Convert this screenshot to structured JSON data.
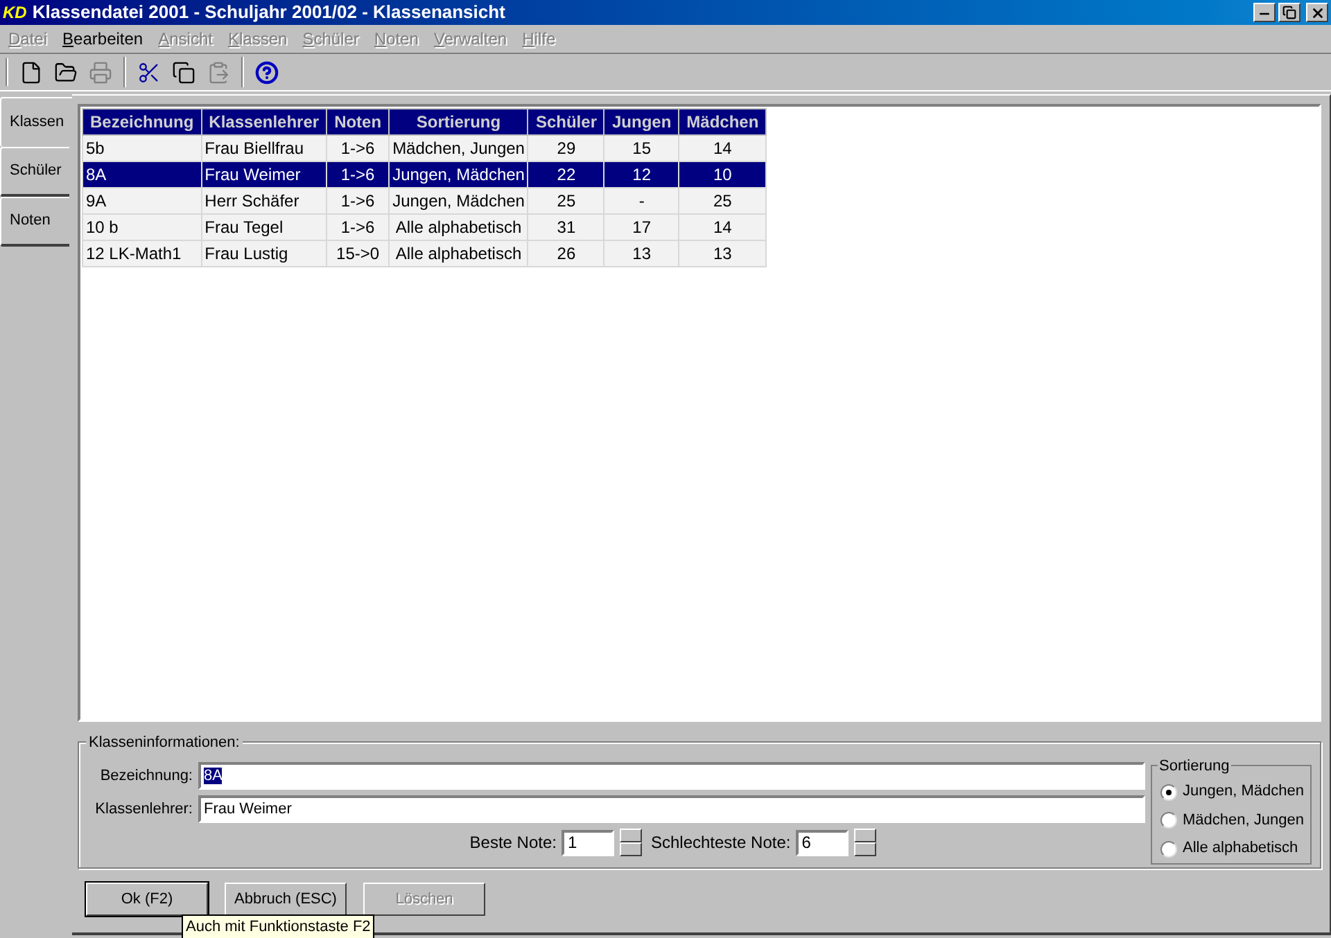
{
  "window": {
    "title": "Klassendatei 2001 - Schuljahr 2001/02 - Klassenansicht",
    "logo": "KD"
  },
  "menu": [
    {
      "label": "Datei",
      "disabled": true
    },
    {
      "label": "Bearbeiten",
      "disabled": false
    },
    {
      "label": "Ansicht",
      "disabled": true
    },
    {
      "label": "Klassen",
      "disabled": true
    },
    {
      "label": "Schüler",
      "disabled": true
    },
    {
      "label": "Noten",
      "disabled": true
    },
    {
      "label": "Verwalten",
      "disabled": true
    },
    {
      "label": "Hilfe",
      "disabled": true
    }
  ],
  "toolbar": [
    {
      "kind": "new",
      "disabled": false
    },
    {
      "kind": "open",
      "disabled": false
    },
    {
      "kind": "print",
      "disabled": true
    },
    {
      "kind": "sep"
    },
    {
      "kind": "cut",
      "disabled": false
    },
    {
      "kind": "copy",
      "disabled": false
    },
    {
      "kind": "paste",
      "disabled": true
    },
    {
      "kind": "sep"
    },
    {
      "kind": "help",
      "disabled": false
    }
  ],
  "side_tabs": [
    {
      "label": "Klassen",
      "selected": true
    },
    {
      "label": "Schüler",
      "selected": false
    },
    {
      "label": "Noten",
      "selected": false
    }
  ],
  "table": {
    "columns": [
      "Bezeichnung",
      "Klassenlehrer",
      "Noten",
      "Sortierung",
      "Schüler",
      "Jungen",
      "Mädchen"
    ],
    "rows": [
      {
        "cells": [
          "5b",
          "Frau Biellfrau",
          "1->6",
          "Mädchen, Jungen",
          "29",
          "15",
          "14"
        ],
        "selected": false
      },
      {
        "cells": [
          "8A",
          "Frau Weimer",
          "1->6",
          "Jungen, Mädchen",
          "22",
          "12",
          "10"
        ],
        "selected": true
      },
      {
        "cells": [
          "9A",
          "Herr Schäfer",
          "1->6",
          "Jungen, Mädchen",
          "25",
          "-",
          "25"
        ],
        "selected": false
      },
      {
        "cells": [
          "10 b",
          "Frau Tegel",
          "1->6",
          "Alle alphabetisch",
          "31",
          "17",
          "14"
        ],
        "selected": false
      },
      {
        "cells": [
          "12 LK-Math1",
          "Frau Lustig",
          "15->0",
          "Alle alphabetisch",
          "26",
          "13",
          "13"
        ],
        "selected": false
      }
    ]
  },
  "info": {
    "title": "Klasseninformationen:",
    "name_label": "Bezeichnung:",
    "name_value": "8A",
    "teacher_label": "Klassenlehrer:",
    "teacher_value": "Frau Weimer",
    "best_label": "Beste Note:",
    "best_value": "1",
    "worst_label": "Schlechteste Note:",
    "worst_value": "6",
    "sort": {
      "title": "Sortierung",
      "options": [
        {
          "label": "Jungen, Mädchen",
          "selected": true
        },
        {
          "label": "Mädchen, Jungen",
          "selected": false
        },
        {
          "label": "Alle alphabetisch",
          "selected": false
        }
      ]
    }
  },
  "buttons": [
    {
      "label": "Ok (F2)",
      "default": true,
      "disabled": false
    },
    {
      "label": "Abbruch (ESC)",
      "default": false,
      "disabled": false
    },
    {
      "label": "Löschen",
      "default": false,
      "disabled": true
    }
  ],
  "tooltip": "Auch mit Funktionstaste F2"
}
